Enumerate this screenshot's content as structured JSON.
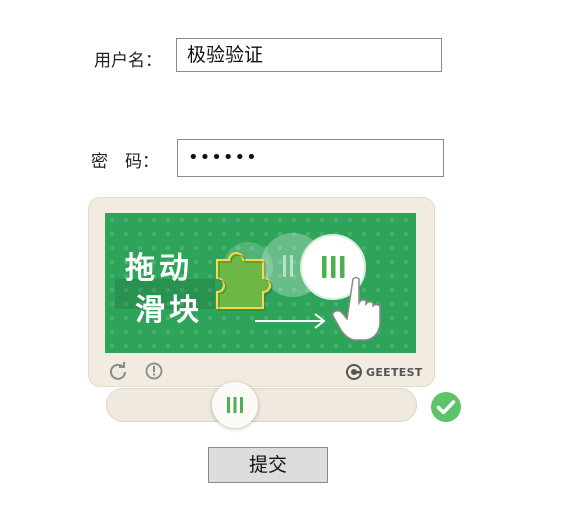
{
  "form": {
    "username_label": "用户名：",
    "username_value": "极验验证",
    "password_label": "密　码：",
    "password_value": "••••••",
    "submit_label": "提交"
  },
  "captcha": {
    "banner_line1": "拖动",
    "banner_line2": "滑块",
    "brand": "GEETEST",
    "colors": {
      "image_bg": "#2ea35a",
      "frame_bg": "#f1ebe0",
      "accent_green": "#5cc36a",
      "handle_bars": "#4caf50"
    },
    "icons": [
      "refresh-icon",
      "info-icon",
      "geetest-logo-icon",
      "grip-icon",
      "success-check-icon"
    ]
  }
}
